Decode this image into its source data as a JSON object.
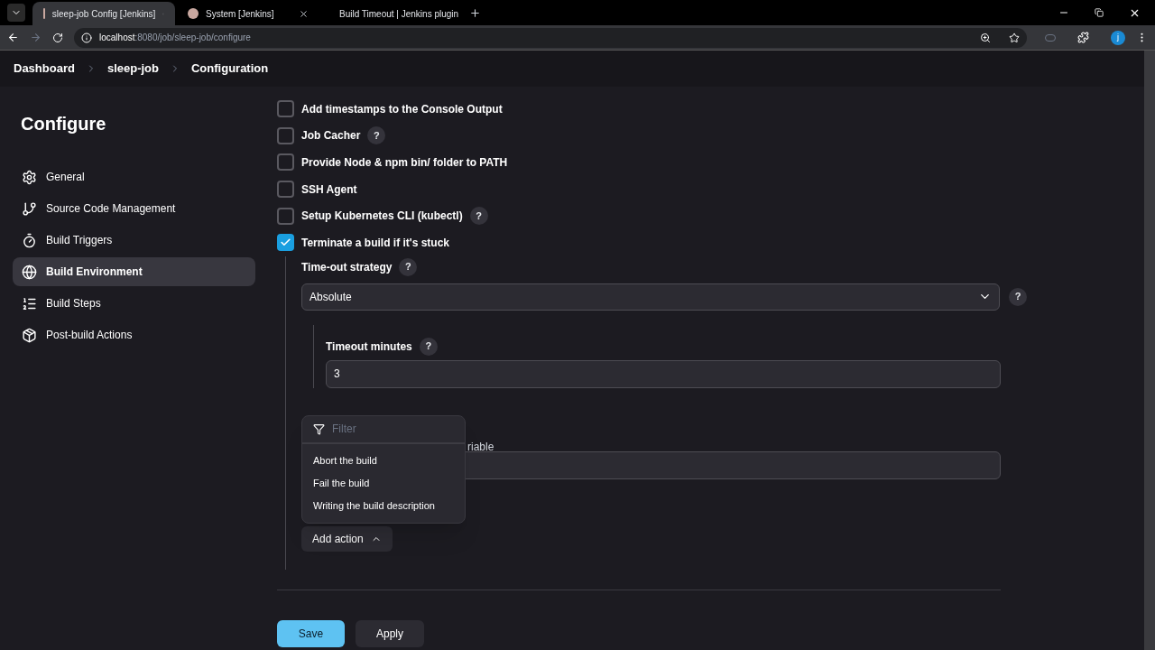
{
  "browser": {
    "tabs": [
      {
        "title": "sleep-job Config [Jenkins]",
        "selected": true
      },
      {
        "title": "System [Jenkins]",
        "selected": false
      },
      {
        "title": "Build Timeout | Jenkins plugin",
        "selected": false
      }
    ],
    "url_host": "localhost",
    "url_path": ":8080/job/sleep-job/configure",
    "profile_initial": "j"
  },
  "breadcrumbs": [
    "Dashboard",
    "sleep-job",
    "Configuration"
  ],
  "sidebar": {
    "title": "Configure",
    "items": [
      {
        "label": "General",
        "selected": false
      },
      {
        "label": "Source Code Management",
        "selected": false
      },
      {
        "label": "Build Triggers",
        "selected": false
      },
      {
        "label": "Build Environment",
        "selected": true
      },
      {
        "label": "Build Steps",
        "selected": false
      },
      {
        "label": "Post-build Actions",
        "selected": false
      }
    ]
  },
  "options": [
    {
      "label": "Add timestamps to the Console Output",
      "checked": false
    },
    {
      "label": "Job Cacher",
      "checked": false,
      "help": "?"
    },
    {
      "label": "Provide Node & npm bin/ folder to PATH",
      "checked": false
    },
    {
      "label": "SSH Agent",
      "checked": false
    },
    {
      "label": "Setup Kubernetes CLI (kubectl)",
      "checked": false,
      "help": "?"
    },
    {
      "label": "Terminate a build if it's stuck",
      "checked": true
    }
  ],
  "timeout_strategy": {
    "label": "Time-out strategy",
    "help": "?",
    "value": "Absolute",
    "select_help": "?"
  },
  "timeout_minutes": {
    "label": "Timeout minutes",
    "help": "?",
    "value": "3"
  },
  "timeout_variable": {
    "hint": "riable"
  },
  "action_menu": {
    "placeholder": "Filter",
    "items": [
      "Abort the build",
      "Fail the build",
      "Writing the build description"
    ]
  },
  "add_action": "Add action",
  "buttons": {
    "save": "Save",
    "apply": "Apply"
  }
}
